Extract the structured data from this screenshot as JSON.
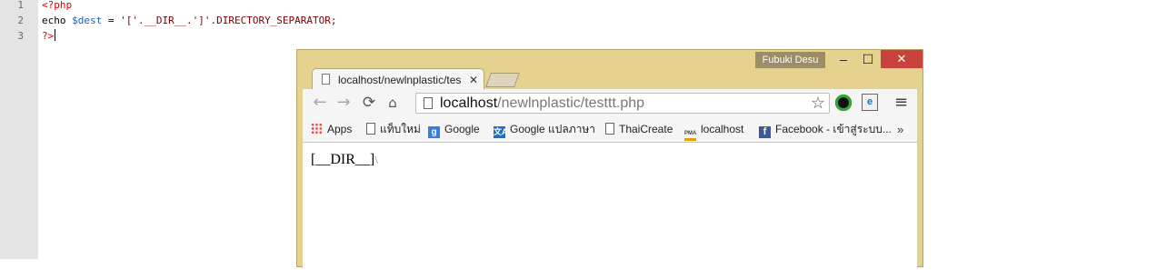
{
  "editor": {
    "line_numbers": [
      "1",
      "2",
      "3"
    ],
    "line1": "<?php",
    "line2": {
      "echo": "echo ",
      "var": "$dest",
      "assign": " = ",
      "expr": "'['.__DIR__.']'.DIRECTORY_SEPARATOR;"
    },
    "line3": "?>"
  },
  "browser": {
    "user_name": "Fubuki Desu",
    "window_buttons": {
      "minimize": "–",
      "maximize": "☐",
      "close": "✕"
    },
    "tab": {
      "title": "localhost/newlnplastic/tes",
      "close": "✕"
    },
    "nav_icons": {
      "back": "←",
      "forward": "→",
      "reload": "⟳",
      "home": "⌂"
    },
    "address": {
      "host": "localhost",
      "path": "/newlnplastic/testtt.php"
    },
    "star": "☆",
    "menu": "≡",
    "bookmarks": [
      {
        "label": "Apps",
        "icon": "apps-icon"
      },
      {
        "label": "แท็บใหม่",
        "icon": "page-icon"
      },
      {
        "label": "Google",
        "icon": "google-icon",
        "glyph": "g"
      },
      {
        "label": "Google แปลภาษา",
        "icon": "translate-icon",
        "glyph": "文A"
      },
      {
        "label": "ThaiCreate",
        "icon": "page-icon"
      },
      {
        "label": "localhost",
        "icon": "phpmyadmin-icon",
        "glyph": "PMA"
      },
      {
        "label": "Facebook - เข้าสู่ระบบ...",
        "icon": "facebook-icon",
        "glyph": "f"
      }
    ],
    "more_bookmarks": "»",
    "page_output": {
      "text": "[__DIR__]",
      "separator": "\\"
    }
  }
}
